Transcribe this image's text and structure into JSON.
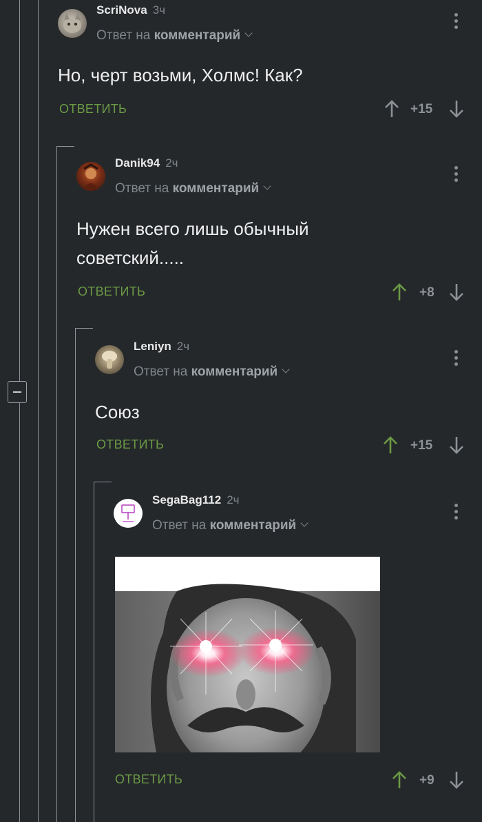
{
  "comments": [
    {
      "username": "ScriNova",
      "time": "3ч",
      "reply_prefix": "Ответ на",
      "reply_target": "комментарий",
      "text": "Но, черт возьми, Холмс! Как?",
      "reply_label": "ОТВЕТИТЬ",
      "rating": "+15",
      "upvoted": false
    },
    {
      "username": "Danik94",
      "time": "2ч",
      "reply_prefix": "Ответ на",
      "reply_target": "комментарий",
      "text_line1": "Нужен всего лишь обычный",
      "text_line2": "советский.....",
      "reply_label": "ОТВЕТИТЬ",
      "rating": "+8",
      "upvoted": true
    },
    {
      "username": "Leniyn",
      "time": "2ч",
      "reply_prefix": "Ответ на",
      "reply_target": "комментарий",
      "text": "Союз",
      "reply_label": "ОТВЕТИТЬ",
      "rating": "+15",
      "upvoted": true
    },
    {
      "username": "SegaBag112",
      "time": "2ч",
      "reply_prefix": "Ответ на",
      "reply_target": "комментарий",
      "reply_label": "ОТВЕТИТЬ",
      "rating": "+9",
      "upvoted": true
    }
  ],
  "colors": {
    "background": "#25282b",
    "accent_green": "#6b9a45",
    "muted": "#80868b"
  },
  "icons": [
    "collapse-thread-icon",
    "more-options-icon",
    "upvote-arrow-icon",
    "downvote-arrow-icon",
    "chevron-down-icon"
  ]
}
